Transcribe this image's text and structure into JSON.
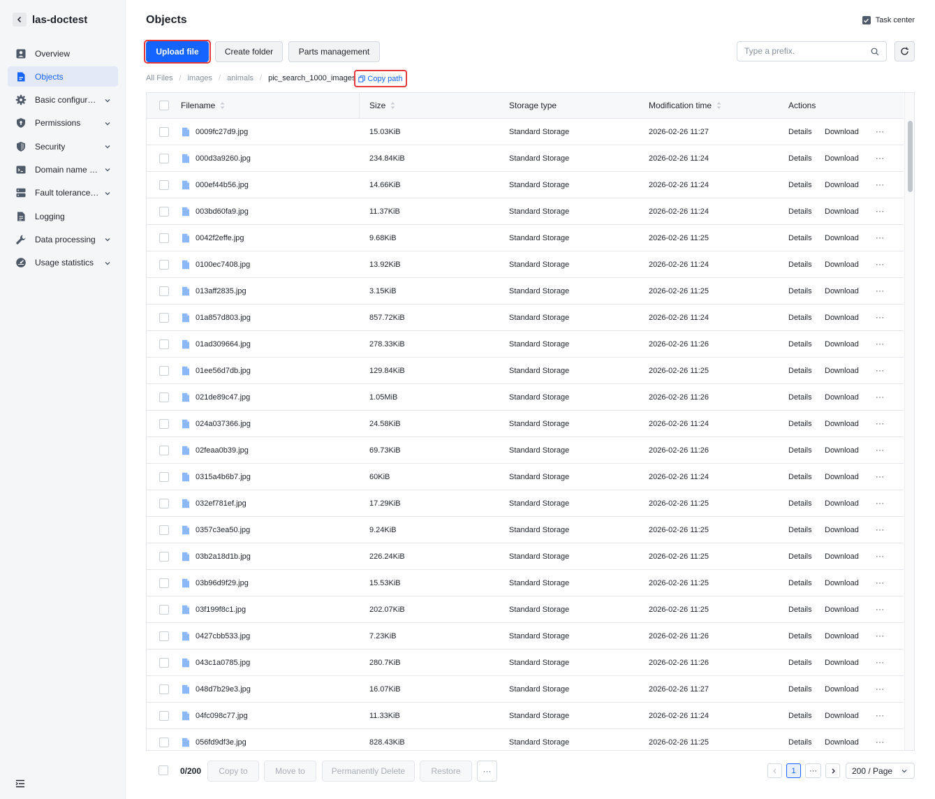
{
  "sidebar": {
    "bucket_name": "las-doctest",
    "items": [
      {
        "label": "Overview",
        "icon": "overview-icon",
        "expandable": false,
        "active": false
      },
      {
        "label": "Objects",
        "icon": "objects-icon",
        "expandable": false,
        "active": true
      },
      {
        "label": "Basic configurat…",
        "icon": "gear-icon",
        "expandable": true,
        "active": false
      },
      {
        "label": "Permissions",
        "icon": "permissions-icon",
        "expandable": true,
        "active": false
      },
      {
        "label": "Security",
        "icon": "shield-icon",
        "expandable": true,
        "active": false
      },
      {
        "label": "Domain name a…",
        "icon": "domain-icon",
        "expandable": true,
        "active": false
      },
      {
        "label": "Fault tolerance …",
        "icon": "fault-tolerance-icon",
        "expandable": true,
        "active": false
      },
      {
        "label": "Logging",
        "icon": "logging-icon",
        "expandable": false,
        "active": false
      },
      {
        "label": "Data processing",
        "icon": "wrench-icon",
        "expandable": true,
        "active": false
      },
      {
        "label": "Usage statistics",
        "icon": "usage-icon",
        "expandable": true,
        "active": false
      }
    ]
  },
  "header": {
    "title": "Objects",
    "task_center": "Task center"
  },
  "toolbar": {
    "upload_label": "Upload file",
    "create_folder_label": "Create folder",
    "parts_label": "Parts management",
    "search_placeholder": "Type a prefix."
  },
  "breadcrumb": {
    "items": [
      "All Files",
      "images",
      "animals",
      "pic_search_1000_images"
    ],
    "copy_path_label": "Copy path"
  },
  "table": {
    "headers": {
      "filename": "Filename",
      "size": "Size",
      "storage": "Storage type",
      "mtime": "Modification time",
      "actions": "Actions"
    },
    "details_label": "Details",
    "download_label": "Download",
    "rows": [
      {
        "name": "0009fc27d9.jpg",
        "size": "15.03KiB",
        "storage": "Standard Storage",
        "mtime": "2026-02-26 11:27"
      },
      {
        "name": "000d3a9260.jpg",
        "size": "234.84KiB",
        "storage": "Standard Storage",
        "mtime": "2026-02-26 11:24"
      },
      {
        "name": "000ef44b56.jpg",
        "size": "14.66KiB",
        "storage": "Standard Storage",
        "mtime": "2026-02-26 11:24"
      },
      {
        "name": "003bd60fa9.jpg",
        "size": "11.37KiB",
        "storage": "Standard Storage",
        "mtime": "2026-02-26 11:24"
      },
      {
        "name": "0042f2effe.jpg",
        "size": "9.68KiB",
        "storage": "Standard Storage",
        "mtime": "2026-02-26 11:25"
      },
      {
        "name": "0100ec7408.jpg",
        "size": "13.92KiB",
        "storage": "Standard Storage",
        "mtime": "2026-02-26 11:24"
      },
      {
        "name": "013aff2835.jpg",
        "size": "3.15KiB",
        "storage": "Standard Storage",
        "mtime": "2026-02-26 11:25"
      },
      {
        "name": "01a857d803.jpg",
        "size": "857.72KiB",
        "storage": "Standard Storage",
        "mtime": "2026-02-26 11:24"
      },
      {
        "name": "01ad309664.jpg",
        "size": "278.33KiB",
        "storage": "Standard Storage",
        "mtime": "2026-02-26 11:26"
      },
      {
        "name": "01ee56d7db.jpg",
        "size": "129.84KiB",
        "storage": "Standard Storage",
        "mtime": "2026-02-26 11:25"
      },
      {
        "name": "021de89c47.jpg",
        "size": "1.05MiB",
        "storage": "Standard Storage",
        "mtime": "2026-02-26 11:26"
      },
      {
        "name": "024a037366.jpg",
        "size": "24.58KiB",
        "storage": "Standard Storage",
        "mtime": "2026-02-26 11:24"
      },
      {
        "name": "02feaa0b39.jpg",
        "size": "69.73KiB",
        "storage": "Standard Storage",
        "mtime": "2026-02-26 11:26"
      },
      {
        "name": "0315a4b6b7.jpg",
        "size": "60KiB",
        "storage": "Standard Storage",
        "mtime": "2026-02-26 11:24"
      },
      {
        "name": "032ef781ef.jpg",
        "size": "17.29KiB",
        "storage": "Standard Storage",
        "mtime": "2026-02-26 11:25"
      },
      {
        "name": "0357c3ea50.jpg",
        "size": "9.24KiB",
        "storage": "Standard Storage",
        "mtime": "2026-02-26 11:25"
      },
      {
        "name": "03b2a18d1b.jpg",
        "size": "226.24KiB",
        "storage": "Standard Storage",
        "mtime": "2026-02-26 11:25"
      },
      {
        "name": "03b96d9f29.jpg",
        "size": "15.53KiB",
        "storage": "Standard Storage",
        "mtime": "2026-02-26 11:25"
      },
      {
        "name": "03f199f8c1.jpg",
        "size": "202.07KiB",
        "storage": "Standard Storage",
        "mtime": "2026-02-26 11:25"
      },
      {
        "name": "0427cbb533.jpg",
        "size": "7.23KiB",
        "storage": "Standard Storage",
        "mtime": "2026-02-26 11:26"
      },
      {
        "name": "043c1a0785.jpg",
        "size": "280.7KiB",
        "storage": "Standard Storage",
        "mtime": "2026-02-26 11:26"
      },
      {
        "name": "048d7b29e3.jpg",
        "size": "16.07KiB",
        "storage": "Standard Storage",
        "mtime": "2026-02-26 11:27"
      },
      {
        "name": "04fc098c77.jpg",
        "size": "11.33KiB",
        "storage": "Standard Storage",
        "mtime": "2026-02-26 11:24"
      },
      {
        "name": "056fd9df3e.jpg",
        "size": "828.43KiB",
        "storage": "Standard Storage",
        "mtime": "2026-02-26 11:25"
      }
    ]
  },
  "footer": {
    "selected_count": "0/200",
    "copy_to": "Copy to",
    "move_to": "Move to",
    "permanently_delete": "Permanently Delete",
    "restore": "Restore",
    "current_page": "1",
    "page_size": "200",
    "page_size_suffix": "/ Page"
  },
  "colors": {
    "accent": "#1664ff",
    "highlight_box": "#e5383b",
    "sidebar_bg": "#f5f6f8"
  }
}
